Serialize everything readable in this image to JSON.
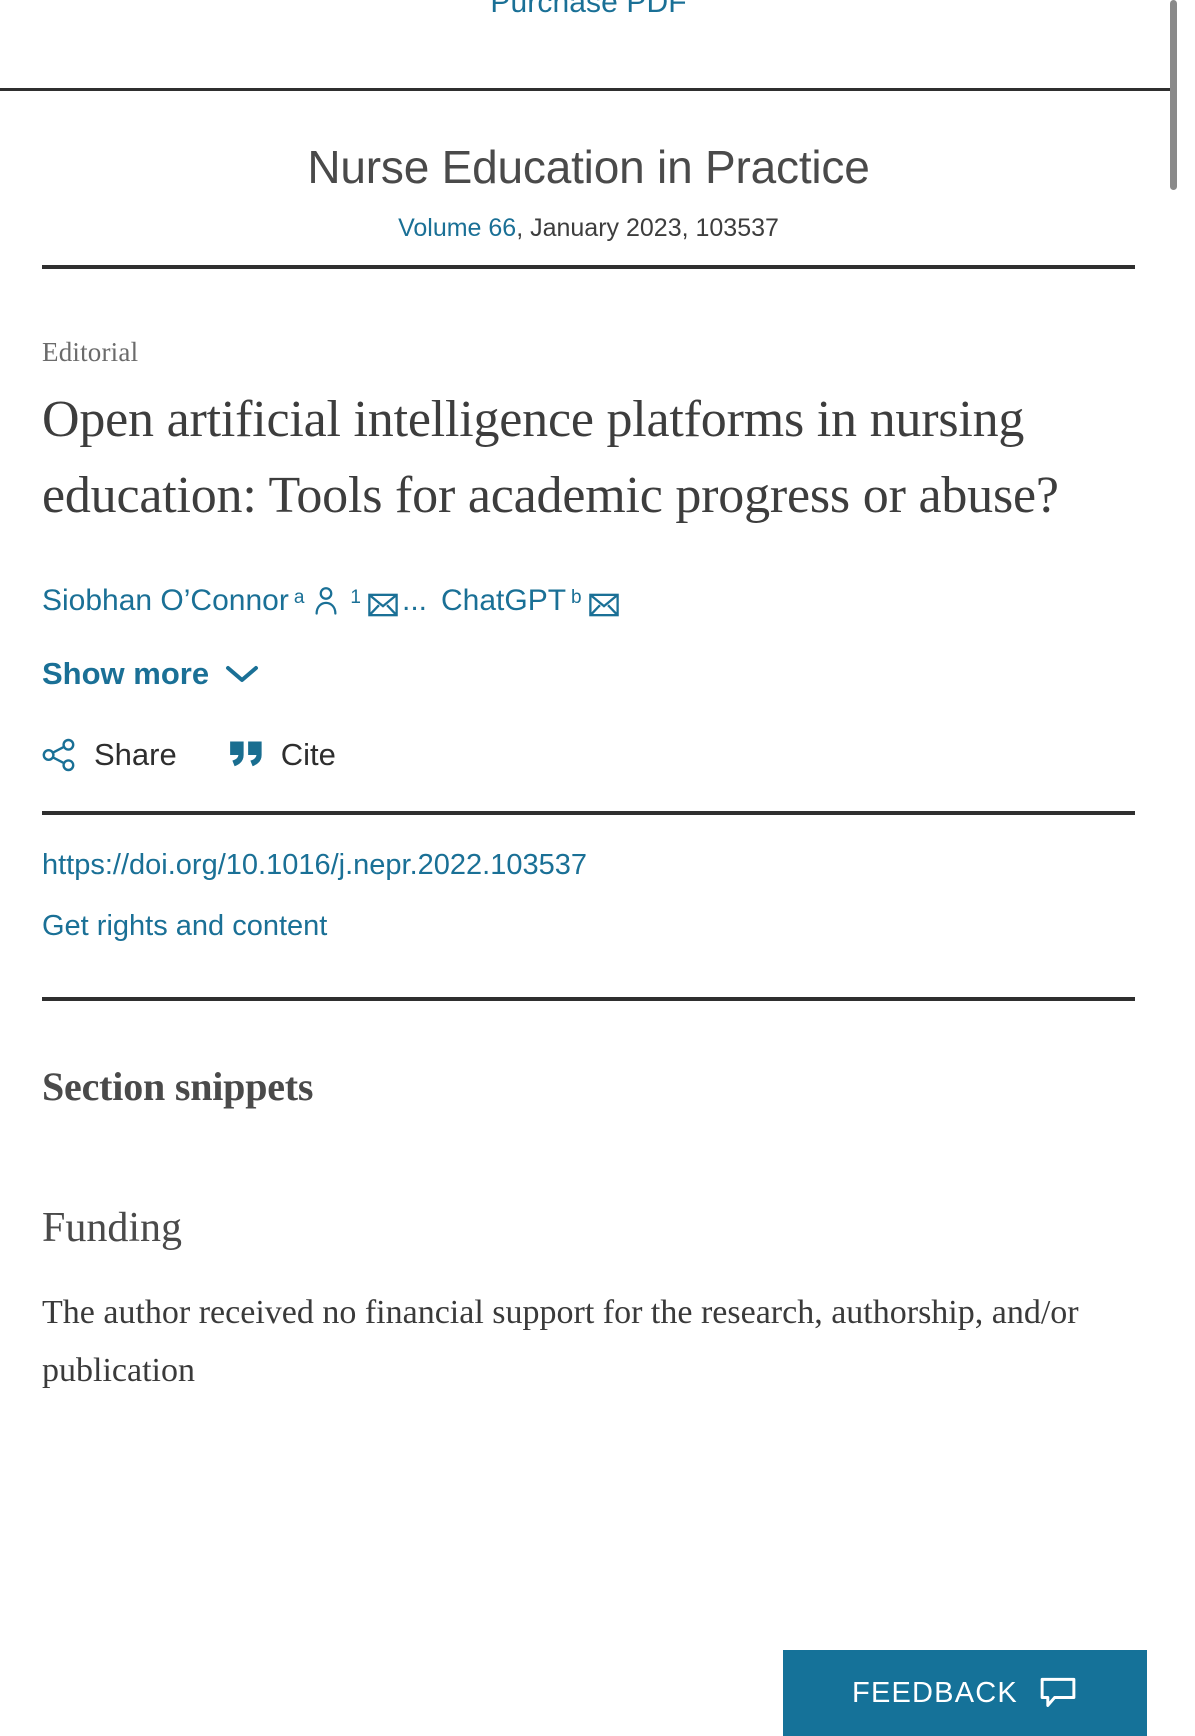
{
  "top_bar": {
    "purchase_pdf_label": "Purchase PDF"
  },
  "journal": {
    "name": "Nurse Education in Practice",
    "volume_link": "Volume 66",
    "volume_rest": ", January 2023, 103537"
  },
  "article": {
    "type": "Editorial",
    "title": "Open artificial intelligence platforms in nursing education: Tools for academic progress or abuse?",
    "authors": [
      {
        "name": "Siobhan O’Connor",
        "affiliation": "a",
        "note": "1",
        "has_person_icon": true,
        "has_envelope_icon": true
      },
      {
        "name": "ChatGPT",
        "affiliation": "b",
        "has_person_icon": false,
        "has_envelope_icon": true
      }
    ],
    "author_ellipsis": "...",
    "show_more_label": "Show more",
    "doi": "https://doi.org/10.1016/j.nepr.2022.103537",
    "rights_label": "Get rights and content"
  },
  "actions": {
    "share_label": "Share",
    "cite_label": "Cite"
  },
  "sections": {
    "snippets_heading": "Section snippets",
    "funding_heading": "Funding",
    "funding_text": "The author received no financial support for the research, authorship, and/or publication"
  },
  "feedback": {
    "label": "FEEDBACK"
  },
  "icons": {
    "person": "person-icon",
    "envelope": "envelope-icon",
    "chevron_down": "chevron-down-icon",
    "share": "share-icon",
    "quote": "quote-icon",
    "speech_bubble": "speech-bubble-icon"
  },
  "colors": {
    "link": "#1a7096",
    "feedback_bg": "#157299",
    "rule": "#2f2f2f",
    "body_text": "#3a3a3a"
  }
}
